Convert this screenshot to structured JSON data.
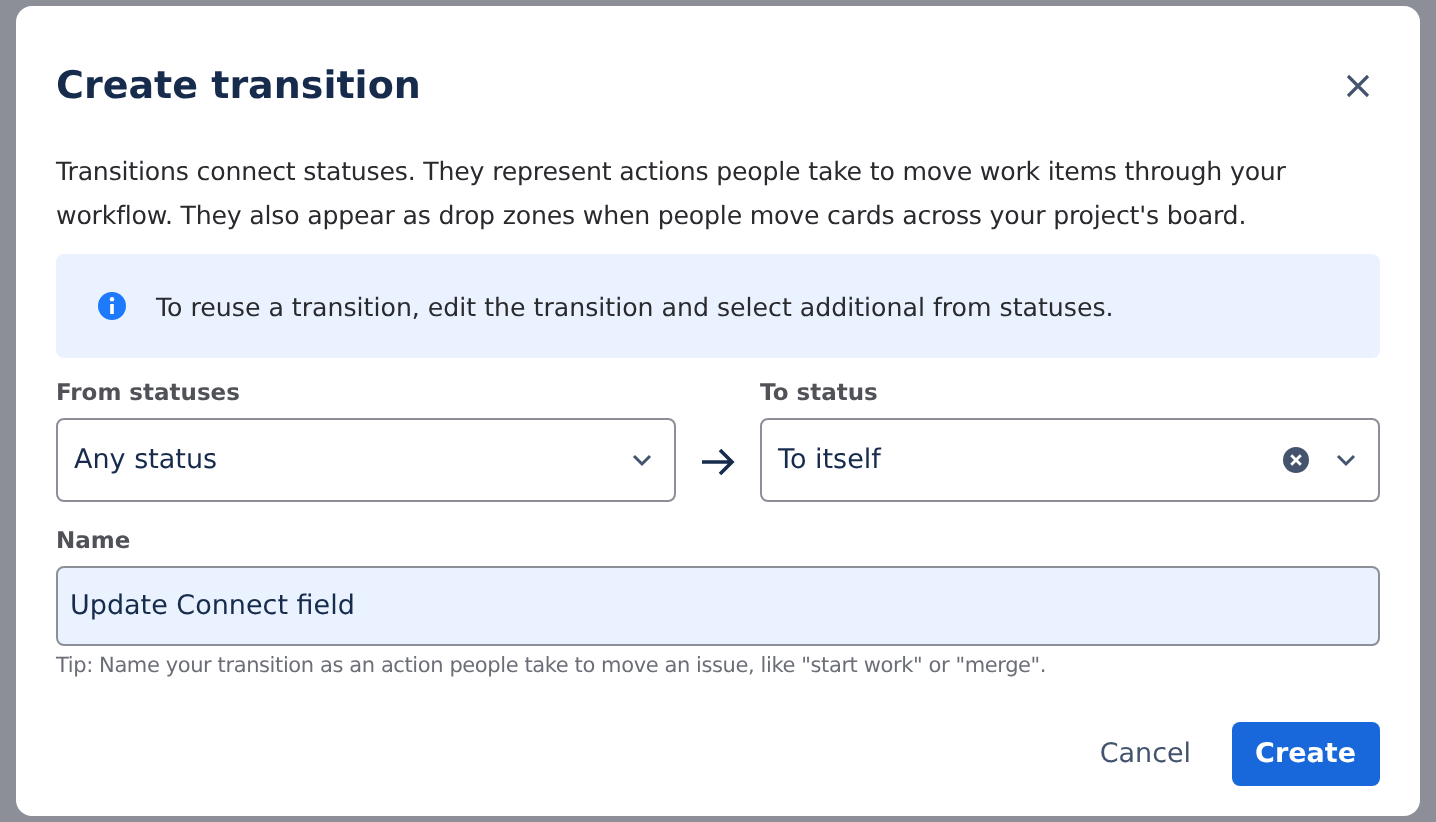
{
  "dialog": {
    "title": "Create transition",
    "description": "Transitions connect statuses. They represent actions people take to move work items through your workflow. They also appear as drop zones when people move cards across your project's board.",
    "info_message": "To reuse a transition, edit the transition and select additional from statuses.",
    "from_statuses": {
      "label": "From statuses",
      "value": "Any status"
    },
    "to_status": {
      "label": "To status",
      "value": "To itself",
      "clearable": true
    },
    "name": {
      "label": "Name",
      "value": "Update Connect field",
      "focused": true
    },
    "tip": "Tip: Name your transition as an action people take to move an issue, like \"start work\" or \"merge\".",
    "buttons": [
      {
        "label": "Cancel",
        "kind": "subtle"
      },
      {
        "label": "Create",
        "kind": "primary"
      }
    ]
  }
}
